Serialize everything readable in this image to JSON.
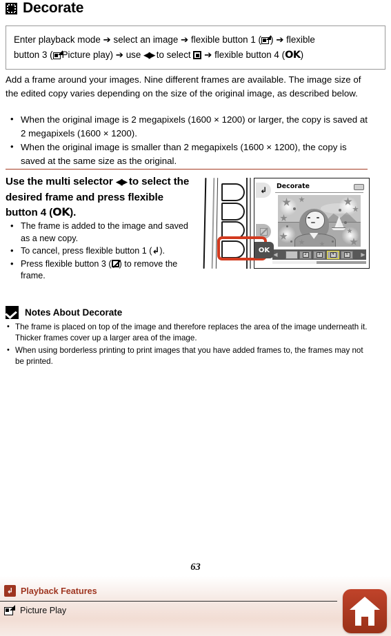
{
  "page": {
    "title": "Decorate",
    "title_icon": "decorate-frame-icon",
    "page_number": "63"
  },
  "steps_box": {
    "line1_a": "Enter playback mode",
    "line1_b": "select an image",
    "line1_c": "flexible button 1 (",
    "line1_icon": "picture-play-icon",
    "line1_d": ")",
    "line1_e": "flexible",
    "line2_a": "button 3 (",
    "line2_icon": "picture-play-icon",
    "line2_b": "Picture play)",
    "line2_c": "use",
    "line2_arrows": "multi-selector-left-right-icon",
    "line2_d": "to select",
    "line2_icon2": "decorate-frame-icon",
    "line2_e": "flexible button 4 (",
    "line2_ok": "OK",
    "line2_f": ")",
    "arrow_glyph": "➔"
  },
  "intro": {
    "paragraph": "Add a frame around your images. Nine different frames are available. The image size of the edited copy varies depending on the size of the original image, as described below.",
    "bullets": [
      "When the original image is 2 megapixels (1600 × 1200) or larger, the copy is saved at 2 megapixels (1600 × 1200).",
      "When the original image is smaller than 2 megapixels (1600 × 1200), the copy is saved at the same size as the original."
    ]
  },
  "step_section": {
    "heading_a": "Use the multi selector",
    "heading_arrows": "multi-selector-left-right-icon",
    "heading_b": "to select the desired frame and press flexible button 4 (",
    "heading_ok": "OK",
    "heading_c": ").",
    "bullets": [
      {
        "text_a": "The frame is added to the image and saved as a new copy.",
        "icon": null,
        "text_b": ""
      },
      {
        "text_a": "To cancel, press flexible button 1 (",
        "icon": "back-arrow-icon",
        "text_b": ")."
      },
      {
        "text_a": "Press flexible button 3 (",
        "icon": "no-decorate-icon",
        "text_b": ") to remove the frame."
      }
    ]
  },
  "camera": {
    "screen_title": "Decorate",
    "ok_label": "OK",
    "back_icon": "back-arrow-icon",
    "no_decorate_icon": "no-decorate-icon",
    "battery_icon": "battery-icon",
    "highlight_color": "#d23a1f",
    "selected_frame_index": 4,
    "frames": [
      {
        "label": "",
        "selected": false,
        "blank": true
      },
      {
        "label": "2",
        "selected": false,
        "blank": false
      },
      {
        "label": "3",
        "selected": false,
        "blank": false
      },
      {
        "label": "4",
        "selected": true,
        "blank": false
      },
      {
        "label": "5",
        "selected": false,
        "blank": false
      }
    ],
    "arrow_left": "◀",
    "arrow_right": "▶"
  },
  "notes": {
    "icon": "caution-checkmark-icon",
    "title": "Notes About Decorate",
    "bullets": [
      "The frame is placed on top of the image and therefore replaces the area of the image underneath it. Thicker frames cover up a larger area of the image.",
      "When using borderless printing to print images that you have added frames to, the frames may not be printed."
    ]
  },
  "footer": {
    "breadcrumb_1": "Playback Features",
    "breadcrumb_1_icon": "back-arrow-icon",
    "breadcrumb_2": "Picture Play",
    "breadcrumb_2_icon": "picture-play-icon",
    "home_icon": "home-icon",
    "accent_color": "#9e3520"
  }
}
